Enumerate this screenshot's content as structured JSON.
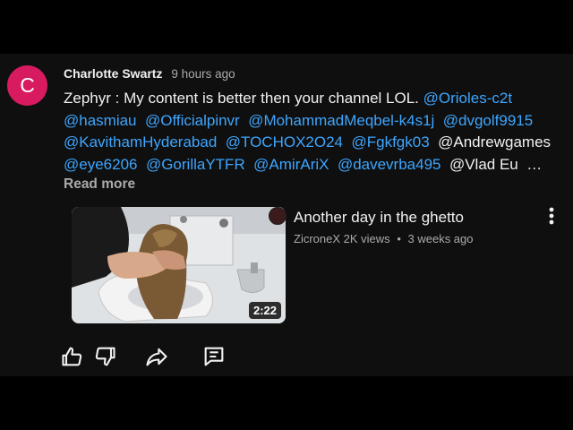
{
  "comment": {
    "avatar_letter": "C",
    "author": "Charlotte Swartz",
    "time": "9 hours ago",
    "lines": [
      [
        {
          "text": "Zephyr : My content is better then your channel LOL. ",
          "link": false
        },
        {
          "text": "@Orioles-c2t",
          "link": true
        }
      ],
      [
        {
          "text": "@hasmiau",
          "link": true
        },
        {
          "text": "  ",
          "link": false
        },
        {
          "text": "@Officialpinvr",
          "link": true
        },
        {
          "text": "  ",
          "link": false
        },
        {
          "text": "@MohammadMeqbel-k4s1j",
          "link": true
        },
        {
          "text": "  ",
          "link": false
        },
        {
          "text": "@dvgolf9915",
          "link": true
        }
      ],
      [
        {
          "text": "@KavithamHyderabad",
          "link": true
        },
        {
          "text": "  ",
          "link": false
        },
        {
          "text": "@TOCHOX2O24",
          "link": true
        },
        {
          "text": "  ",
          "link": false
        },
        {
          "text": "@Fgkfgk03",
          "link": true
        },
        {
          "text": "  @Andrewgames",
          "link": false
        }
      ],
      [
        {
          "text": "@eye6206",
          "link": true
        },
        {
          "text": "  ",
          "link": false
        },
        {
          "text": "@GorillaYTFR",
          "link": true
        },
        {
          "text": "  ",
          "link": false
        },
        {
          "text": "@AmirAriX",
          "link": true
        },
        {
          "text": "  ",
          "link": false
        },
        {
          "text": "@davevrba495",
          "link": true
        },
        {
          "text": "  @Vlad Eu  …",
          "link": false
        }
      ]
    ],
    "read_more": "Read more"
  },
  "video": {
    "title": "Another day in the ghetto",
    "channel": "ZicroneX",
    "views": "2K views",
    "age": "3 weeks ago",
    "duration": "2:22"
  },
  "colors": {
    "link": "#3ea6ff",
    "avatar": "#d81b60",
    "secondary_text": "#aaaaaa"
  },
  "icons": [
    "like-icon",
    "dislike-icon",
    "share-icon",
    "reply-icon",
    "more-vert-icon"
  ]
}
